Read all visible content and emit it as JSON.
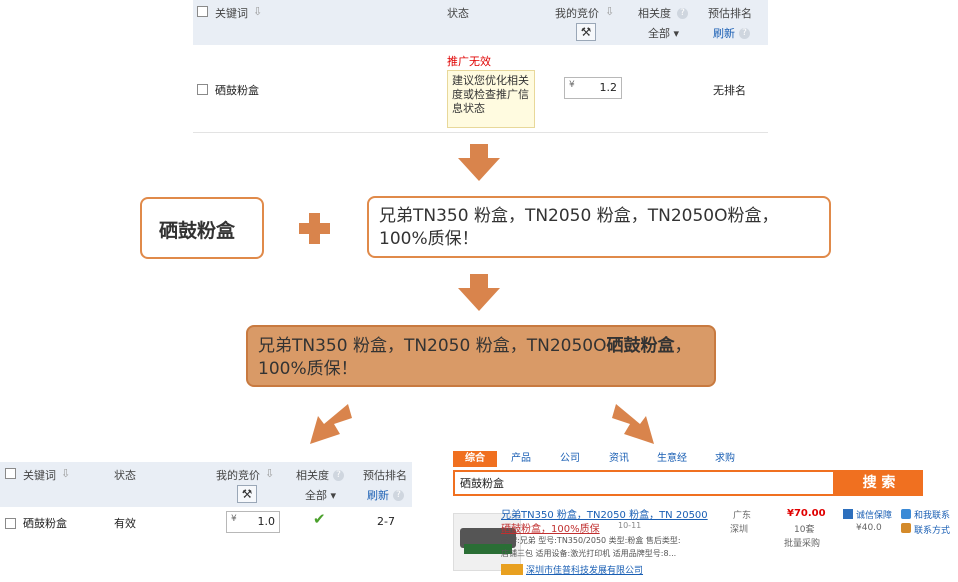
{
  "top_table": {
    "header": {
      "keyword": "关键词",
      "status": "状态",
      "my_bid": "我的竞价",
      "relevance": "相关度",
      "relevance_filter": "全部",
      "est_rank": "预估排名",
      "refresh": "刷新"
    },
    "row": {
      "keyword": "硒鼓粉盒",
      "status_error": "推广无效",
      "status_hint": "建议您优化相关度或检查推广信息状态",
      "currency": "¥",
      "bid": "1.2",
      "rank": "无排名"
    }
  },
  "keyword_box": "硒鼓粉盒",
  "title_box": "兄弟TN350 粉盒，TN2050 粉盒，TN2050O粉盒，100%质保！",
  "combined": {
    "part1": "兄弟TN350 粉盒，TN2050 粉盒，TN2050O",
    "bold": "硒鼓粉盒",
    "part2": "，100%质保！"
  },
  "bottom_table": {
    "header": {
      "keyword": "关键词",
      "status": "状态",
      "my_bid": "我的竞价",
      "relevance": "相关度",
      "relevance_filter": "全部",
      "est_rank": "预估排名",
      "refresh": "刷新"
    },
    "row": {
      "keyword": "硒鼓粉盒",
      "status": "有效",
      "currency": "¥",
      "bid": "1.0",
      "rank": "2-7"
    }
  },
  "search_panel": {
    "tabs": [
      "综合",
      "产品",
      "公司",
      "资讯",
      "生意经",
      "求购"
    ],
    "query": "硒鼓粉盒",
    "search_button": "搜 索",
    "result": {
      "title": "兄弟TN350 粉盒，TN2050 粉盒，TN 20500",
      "subtitle": "硒鼓粉盒，100%质保",
      "date": "10-11",
      "meta1": "品牌:兄弟 型号:TN350/2050 类型:粉盒 售后类型:",
      "meta2": "店铺三包 适用设备:激光打印机 适用品牌型号:8...",
      "company": "深圳市佳普科技发展有限公司",
      "location": "广东",
      "city": "深圳",
      "price": "¥70.00",
      "sales": "10套",
      "feature": "批量采购",
      "guarantee": "诚信保障",
      "contact1": "和我联系",
      "price2": "¥40.0",
      "contact2": "联系方式"
    }
  },
  "colors": {
    "accent": "#e08a4a",
    "arrow": "#d9844c",
    "combined_fill": "#d99a67",
    "tab_orange": "#f07020",
    "header_bg": "#e9eef5",
    "link_blue": "#1a5fb4",
    "error_red": "#e00000",
    "check_green": "#4aa02c"
  }
}
